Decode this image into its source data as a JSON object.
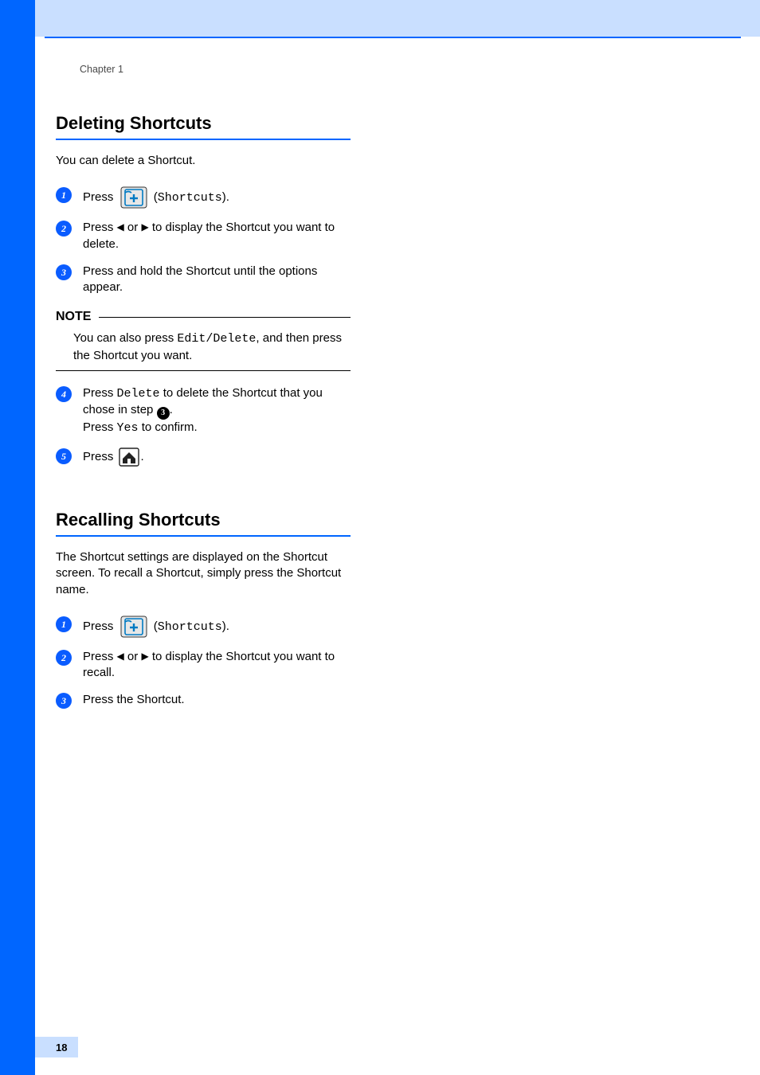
{
  "chapter_label": "Chapter 1",
  "page_number": "18",
  "section1": {
    "title": "Deleting Shortcuts",
    "intro": "You can delete a Shortcut.",
    "steps": {
      "s1": {
        "num": "1",
        "press": "Press ",
        "shortcuts_label": "Shortcuts"
      },
      "s2": {
        "num": "2",
        "t1": "Press ",
        "t2": " or ",
        "t3": " to display the Shortcut you want to delete."
      },
      "s3": {
        "num": "3",
        "text": "Press and hold the Shortcut until the options appear."
      },
      "note": {
        "label": "NOTE",
        "pre": "You can also press ",
        "mono": "Edit/Delete",
        "post": ", and then press the Shortcut you want."
      },
      "s4": {
        "num": "4",
        "pre": "Press ",
        "mono1": "Delete",
        "mid": " to delete the Shortcut that you chose in step ",
        "ref": "3",
        "post1": ".",
        "line2_pre": "Press ",
        "mono2": "Yes",
        "line2_post": " to confirm."
      },
      "s5": {
        "num": "5",
        "press": "Press "
      }
    }
  },
  "section2": {
    "title": "Recalling Shortcuts",
    "intro": "The Shortcut settings are displayed on the Shortcut screen. To recall a Shortcut, simply press the Shortcut name.",
    "steps": {
      "s1": {
        "num": "1",
        "press": "Press ",
        "shortcuts_label": "Shortcuts"
      },
      "s2": {
        "num": "2",
        "t1": "Press ",
        "t2": " or ",
        "t3": " to display the Shortcut you want to recall."
      },
      "s3": {
        "num": "3",
        "text": "Press the Shortcut."
      }
    }
  }
}
